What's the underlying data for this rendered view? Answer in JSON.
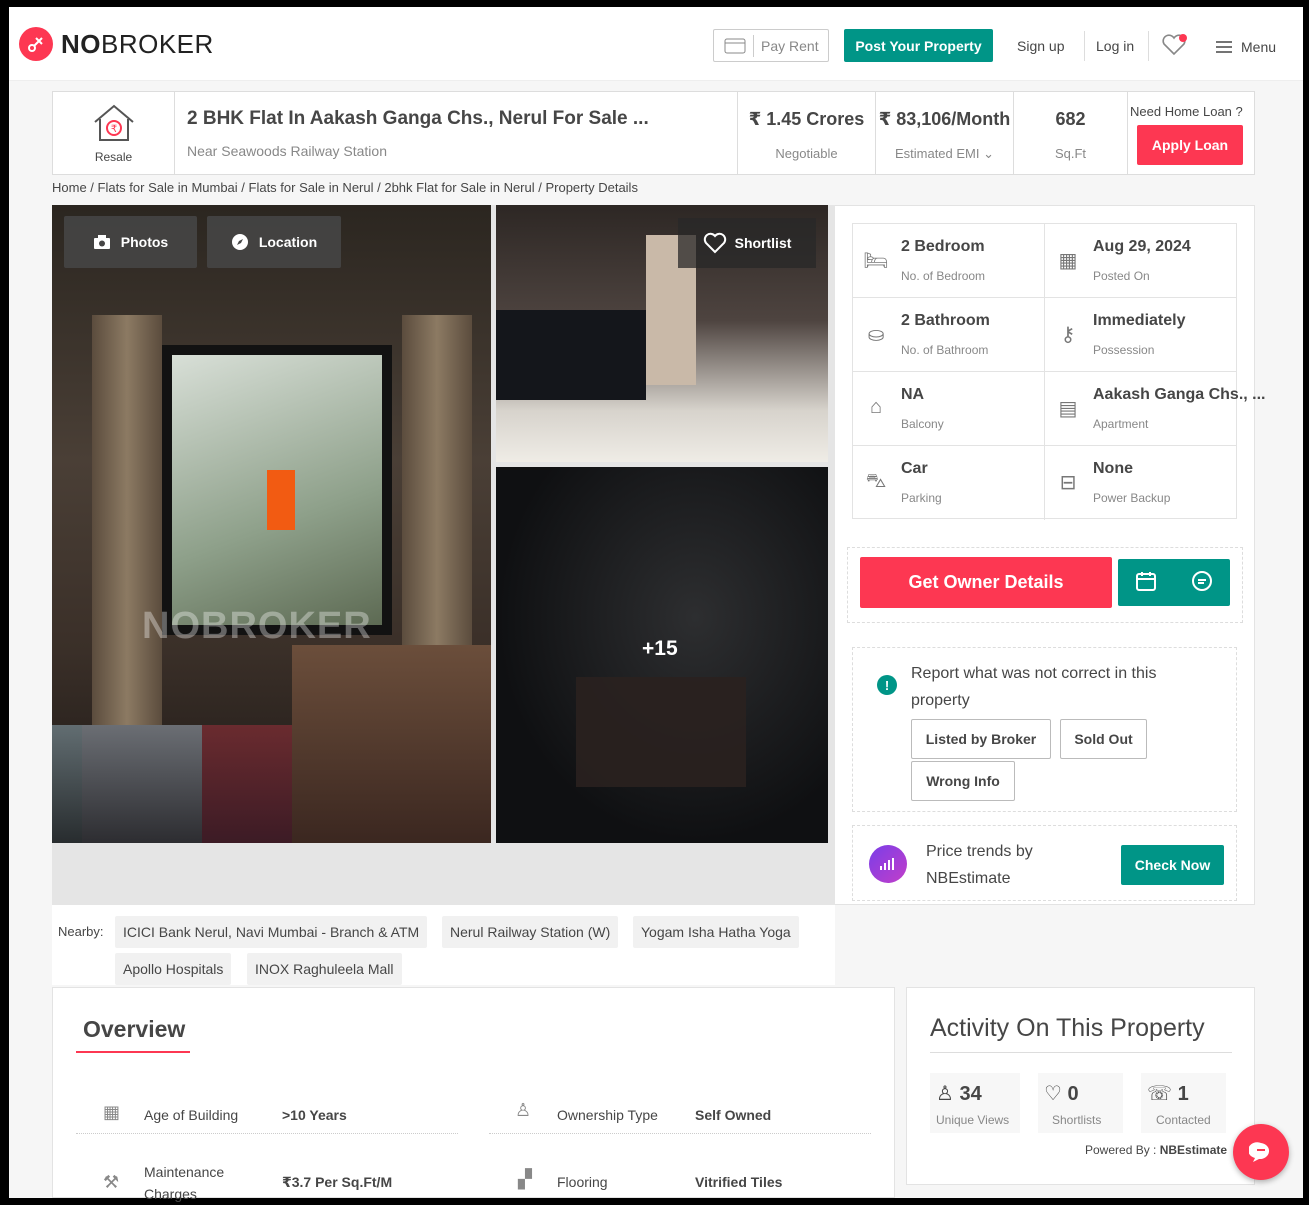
{
  "header": {
    "logo_bold": "NO",
    "logo_rest": "BROKER",
    "pay_rent": "Pay Rent",
    "post_property": "Post Your Property",
    "sign_up": "Sign up",
    "log_in": "Log in",
    "menu": "Menu"
  },
  "property": {
    "type_label": "Resale",
    "title": "2 BHK Flat In Aakash Ganga Chs., Nerul For Sale ...",
    "subtitle": "Near Seawoods Railway Station",
    "price": "₹ 1.45 Crores",
    "price_note": "Negotiable",
    "emi": "₹ 83,106/Month",
    "emi_note": "Estimated EMI",
    "area": "682",
    "area_unit": "Sq.Ft",
    "loan_question": "Need Home Loan ?",
    "apply_loan": "Apply Loan"
  },
  "breadcrumb": "Home / Flats for Sale in Mumbai / Flats for Sale in Nerul / 2bhk Flat for Sale in Nerul / Property Details",
  "gallery": {
    "photos": "Photos",
    "location": "Location",
    "shortlist": "Shortlist",
    "more": "+15",
    "watermark": "NOBROKER"
  },
  "specs": [
    {
      "value": "2 Bedroom",
      "label": "No. of Bedroom",
      "icon": "bed-icon"
    },
    {
      "value": "Aug 29, 2024",
      "label": "Posted On",
      "icon": "calendar-icon"
    },
    {
      "value": "2 Bathroom",
      "label": "No. of Bathroom",
      "icon": "bathtub-icon"
    },
    {
      "value": "Immediately",
      "label": "Possession",
      "icon": "key-icon"
    },
    {
      "value": "NA",
      "label": "Balcony",
      "icon": "balcony-icon"
    },
    {
      "value": "Aakash Ganga Chs., ...",
      "label": "Apartment",
      "icon": "building-icon"
    },
    {
      "value": "Car",
      "label": "Parking",
      "icon": "car-icon"
    },
    {
      "value": "None",
      "label": "Power Backup",
      "icon": "power-icon"
    }
  ],
  "actions": {
    "owner_details": "Get Owner Details",
    "report_text": "Report what was not correct in this property",
    "listed_by_broker": "Listed by Broker",
    "sold_out": "Sold Out",
    "wrong_info": "Wrong Info",
    "trends_text": "Price trends by NBEstimate",
    "check_now": "Check Now"
  },
  "nearby": {
    "label": "Nearby:",
    "places": [
      "ICICI Bank Nerul, Navi Mumbai - Branch & ATM",
      "Nerul Railway Station (W)",
      "Yogam Isha Hatha Yoga",
      "Apollo Hospitals",
      "INOX Raghuleela Mall"
    ]
  },
  "overview": {
    "title": "Overview",
    "rows": [
      {
        "label": "Age of Building",
        "value": ">10 Years"
      },
      {
        "label": "Ownership Type",
        "value": "Self Owned"
      },
      {
        "label": "Maintenance Charges",
        "value": "₹3.7 Per Sq.Ft/M"
      },
      {
        "label": "Flooring",
        "value": "Vitrified Tiles"
      }
    ]
  },
  "activity": {
    "title": "Activity On This Property",
    "views": "34",
    "views_label": "Unique Views",
    "shortlists": "0",
    "shortlists_label": "Shortlists",
    "contacted": "1",
    "contacted_label": "Contacted",
    "powered_by_label": "Powered By :",
    "powered_by_name": "NBEstimate"
  },
  "colors": {
    "brand": "#fd3752",
    "teal": "#009587"
  }
}
